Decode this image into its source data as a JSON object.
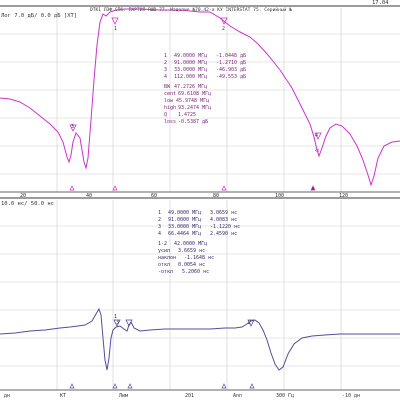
{
  "top_panel": {
    "header_right_fragment": "17.04",
    "title": "DTK1 ЛЭФ СПб. ПАРТИЯ RШD 77. Изделие №70.42-а КУ INTERSTAT 75. Серийный №",
    "scale_label": "Лог 7.0 дБ/ 0.0 дБ [ХТ]",
    "trace_color": "#cc33cc",
    "frequency_tick_labels": [
      "20",
      "40",
      "60",
      "80",
      "100",
      "120"
    ],
    "marker_table": [
      {
        "n": "1",
        "freq": "49.0000 МГц",
        "value": "-1.0448 дБ"
      },
      {
        "n": "2",
        "freq": "91.0000 МГц",
        "value": "-1.2710 дБ"
      },
      {
        "n": "3",
        "freq": "33.0000 МГц",
        "value": "-46.903 дБ"
      },
      {
        "n": "4",
        "freq": "112.000 МГц",
        "value": "-49.553 дБ"
      }
    ],
    "bandwidth_stats": [
      {
        "label": "BW",
        "value": "47.2726 МГц"
      },
      {
        "label": "cent",
        "value": "69.6108 МГц"
      },
      {
        "label": "low",
        "value": "45.9748 МГц"
      },
      {
        "label": "high",
        "value": "93.2474 МГц"
      },
      {
        "label": "Q",
        "value": "1.4725"
      },
      {
        "label": "loss",
        "value": "-0.5387 дБ"
      }
    ],
    "curve_marker_labels": [
      "1",
      "2",
      "3",
      "4"
    ],
    "reference_level_marker": "◁"
  },
  "bottom_panel": {
    "scale_label": "10.0 нс/ 50.0 нс",
    "trace_color": "#5a4a9a",
    "frequency_tick_labels": [
      "дн",
      "КТ",
      "Лим",
      "201",
      "Ann",
      "300 Гц",
      "-10 дн"
    ],
    "marker_table": [
      {
        "n": "1",
        "freq": "49.0000 МГц",
        "value": "3.0659 нс"
      },
      {
        "n": "2",
        "freq": "91.0000 МГц",
        "value": "4.0083 нс"
      },
      {
        "n": "3",
        "freq": "33.0000 МГц",
        "value": "-1.1220 нс"
      },
      {
        "n": "4",
        "freq": "66.4464 МГц",
        "value": "2.4590 нс"
      }
    ],
    "delay_stats": [
      {
        "label": "1-2",
        "value": "42.0000 МГц"
      },
      {
        "label": "усил",
        "value": "3.6659 нс"
      },
      {
        "label": "наклон",
        "value": "-1.1648 нс"
      },
      {
        "label": "откл",
        "value": "0.0054 нс"
      },
      {
        "label": "-откл",
        "value": "5.2060 нс"
      }
    ],
    "curve_marker_labels": [
      "1",
      "3",
      "2"
    ]
  }
}
